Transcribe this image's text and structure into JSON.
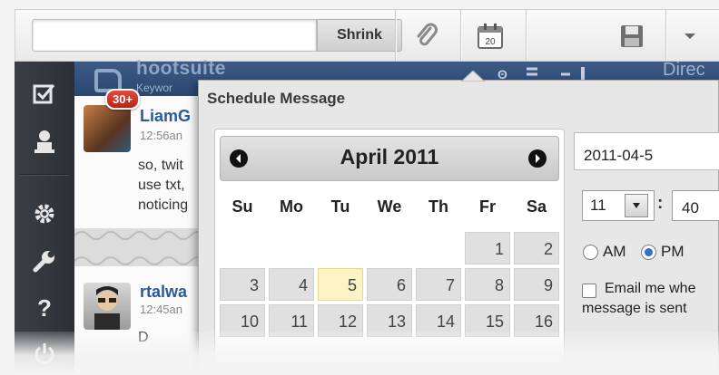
{
  "toolbar": {
    "compose_placeholder": "",
    "shrink_label": "Shrink",
    "calendar_icon_text": "20"
  },
  "leftnav": {
    "icons": [
      "checkbox-icon",
      "person-icon",
      "gear-icon",
      "wrench-icon",
      "help-icon",
      "power-icon"
    ]
  },
  "stream": {
    "brand": "hootsuite",
    "subtitle": "Keywor",
    "header_tail": "Direc",
    "badge": "30+",
    "tweets": [
      {
        "user": "LiamG",
        "time": "12:56an",
        "lines": [
          "so, twit",
          "use txt,",
          "noticing"
        ]
      },
      {
        "user": "rtalwa",
        "time": "12:45an",
        "lines": [
          "D"
        ]
      }
    ]
  },
  "dialog": {
    "title": "Schedule Message",
    "calendar": {
      "month_label": "April 2011",
      "days_of_week": [
        "Su",
        "Mo",
        "Tu",
        "We",
        "Th",
        "Fr",
        "Sa"
      ],
      "rows": [
        [
          "",
          "",
          "",
          "",
          "",
          "1",
          "2"
        ],
        [
          "3",
          "4",
          "5",
          "6",
          "7",
          "8",
          "9"
        ],
        [
          "10",
          "11",
          "12",
          "13",
          "14",
          "15",
          "16"
        ]
      ],
      "today": "5"
    },
    "date_value": "2011-04-5",
    "hour_value": "11",
    "minute_value": "40",
    "am_label": "AM",
    "pm_label": "PM",
    "selected_period": "PM",
    "email_label_line1": "Email me whe",
    "email_label_line2": "message is sent"
  },
  "colors": {
    "accent": "#2f6fc9",
    "stream_header": "#2b4770",
    "badge": "#c8321f",
    "today_cell": "#fbf3c4"
  }
}
